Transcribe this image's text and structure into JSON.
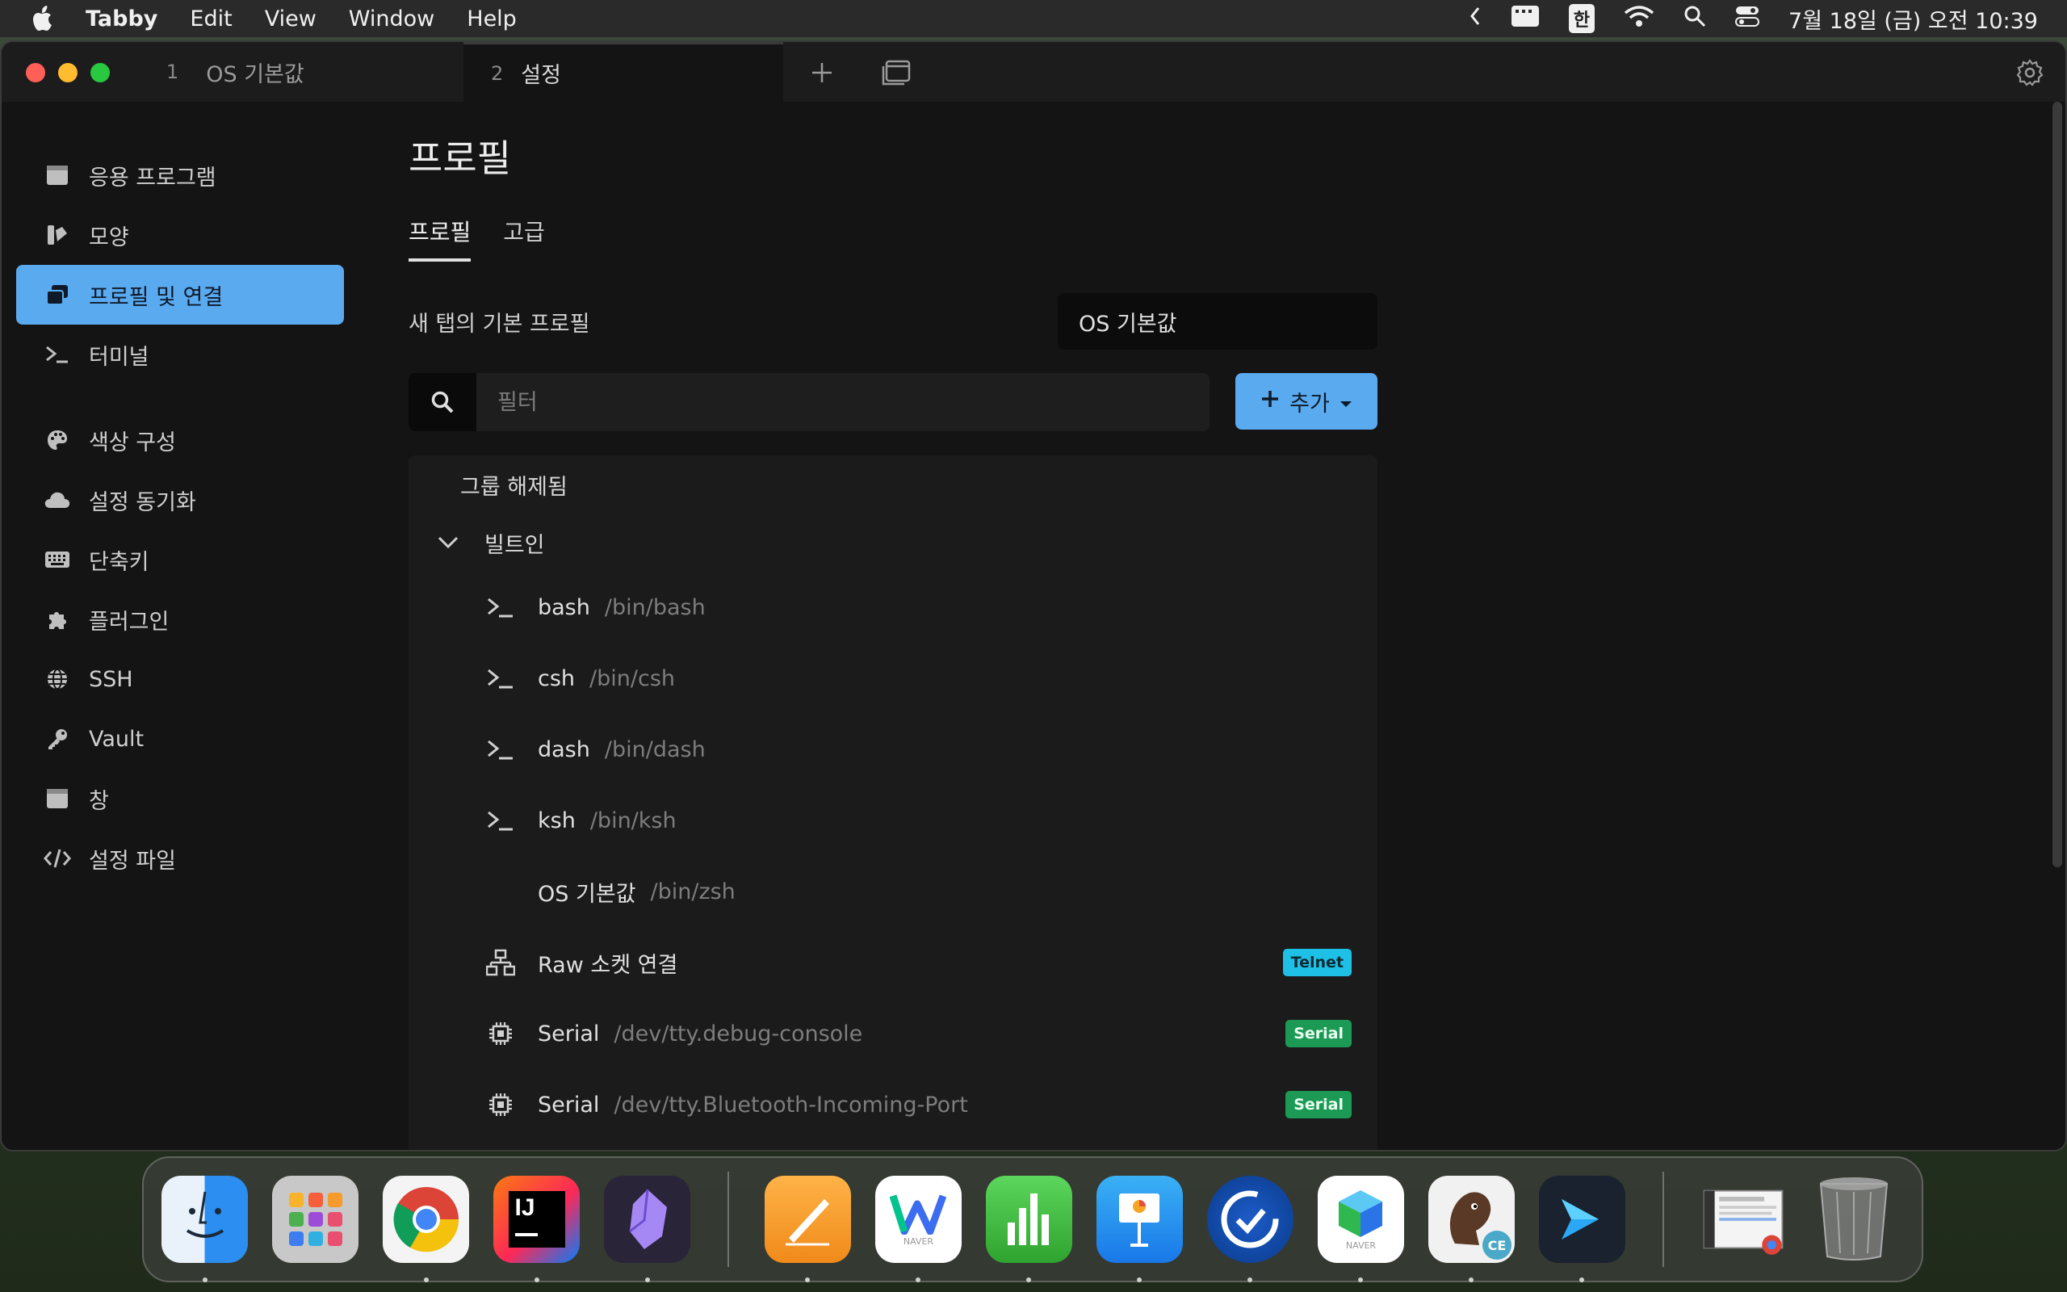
{
  "menubar": {
    "app_name": "Tabby",
    "menus": [
      "Edit",
      "View",
      "Window",
      "Help"
    ],
    "ime": "한",
    "datetime": "7월 18일 (금) 오전 10:39"
  },
  "window": {
    "tabs": [
      {
        "num": "1",
        "label": "OS 기본값"
      },
      {
        "num": "2",
        "label": "설정"
      }
    ]
  },
  "sidebar": {
    "items": [
      {
        "label": "응용 프로그램",
        "icon": "window-icon"
      },
      {
        "label": "모양",
        "icon": "palette-swatch-icon"
      },
      {
        "label": "프로필 및 연결",
        "icon": "windows-stack-icon"
      },
      {
        "label": "터미널",
        "icon": "terminal-icon"
      },
      {
        "label": "색상 구성",
        "icon": "palette-icon"
      },
      {
        "label": "설정 동기화",
        "icon": "cloud-icon"
      },
      {
        "label": "단축키",
        "icon": "keyboard-icon"
      },
      {
        "label": "플러그인",
        "icon": "puzzle-icon"
      },
      {
        "label": "SSH",
        "icon": "globe-icon"
      },
      {
        "label": "Vault",
        "icon": "key-icon"
      },
      {
        "label": "창",
        "icon": "window-icon"
      },
      {
        "label": "설정 파일",
        "icon": "code-icon"
      }
    ]
  },
  "main": {
    "title": "프로필",
    "tabs": [
      "프로필",
      "고급"
    ],
    "default_profile_label": "새 탭의 기본 프로필",
    "default_profile_value": "OS 기본값",
    "filter_placeholder": "필터",
    "add_label": "추가",
    "group_ungrouped": "그룹 해제됨",
    "group_builtin": "빌트인",
    "profiles": [
      {
        "name": "bash",
        "path": "/bin/bash",
        "icon": "terminal-icon",
        "badge": ""
      },
      {
        "name": "csh",
        "path": "/bin/csh",
        "icon": "terminal-icon",
        "badge": ""
      },
      {
        "name": "dash",
        "path": "/bin/dash",
        "icon": "terminal-icon",
        "badge": ""
      },
      {
        "name": "ksh",
        "path": "/bin/ksh",
        "icon": "terminal-icon",
        "badge": ""
      },
      {
        "name": "OS 기본값",
        "path": "/bin/zsh",
        "icon": "",
        "badge": ""
      },
      {
        "name": "Raw 소켓 연결",
        "path": "",
        "icon": "network-icon",
        "badge": "Telnet"
      },
      {
        "name": "Serial",
        "path": "/dev/tty.debug-console",
        "icon": "chip-icon",
        "badge": "Serial"
      },
      {
        "name": "Serial",
        "path": "/dev/tty.Bluetooth-Incoming-Port",
        "icon": "chip-icon",
        "badge": "Serial"
      }
    ]
  },
  "dock": {
    "apps": [
      "Finder",
      "Launchpad",
      "Chrome",
      "IntelliJ IDEA",
      "Obsidian",
      "Pages",
      "Whale",
      "Numbers",
      "Keynote",
      "Sync",
      "NAVER Works",
      "DBeaver CE",
      "Tabby",
      "Preview",
      "Trash"
    ],
    "badge_ce": "CE",
    "badge_naver": "NAVER"
  },
  "colors": {
    "accent": "#5aaaf0",
    "telnet": "#1ec0e6",
    "serial": "#1c9a55"
  }
}
